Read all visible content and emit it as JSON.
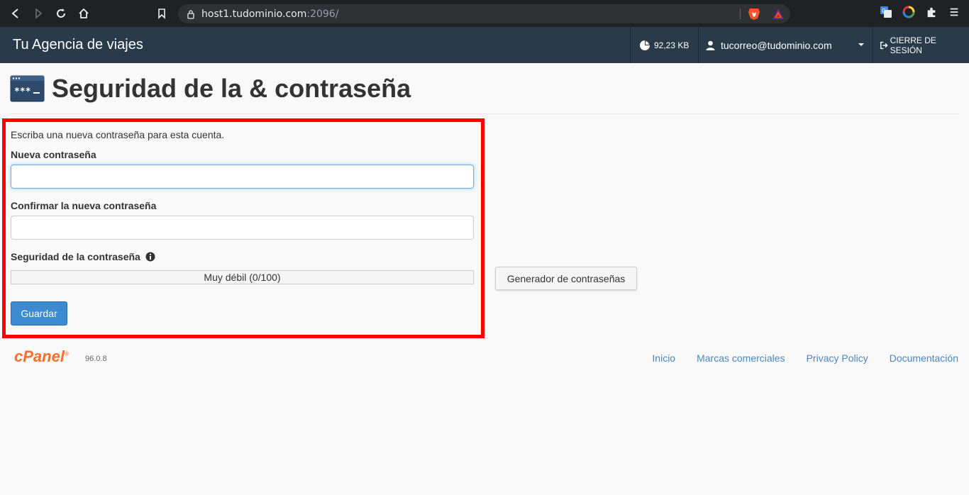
{
  "browser": {
    "url_host": "host1.tudominio.com",
    "url_port": ":2096/"
  },
  "topbar": {
    "brand": "Tu Agencia de viajes",
    "disk_usage": "92,23 KB",
    "user_email": "tucorreo@tudominio.com",
    "logout_label": "CIERRE DE SESIÓN"
  },
  "page": {
    "title": "Seguridad de la & contraseña"
  },
  "form": {
    "intro": "Escriba una nueva contraseña para esta cuenta.",
    "new_password_label": "Nueva contraseña",
    "new_password_value": "",
    "confirm_password_label": "Confirmar la nueva contraseña",
    "confirm_password_value": "",
    "strength_label": "Seguridad de la contraseña",
    "strength_text": "Muy débil (0/100)",
    "strength_value": 0,
    "generator_label": "Generador de contraseñas",
    "save_label": "Guardar"
  },
  "footer": {
    "logo": "cPanel",
    "version": "96.0.8",
    "links": [
      "Inicio",
      "Marcas comerciales",
      "Privacy Policy",
      "Documentación"
    ]
  },
  "colors": {
    "topbar_bg": "#293a4a",
    "highlight": "#ff0000",
    "primary_button": "#3c8ad0",
    "link": "#4a86bf",
    "cpanel_orange": "#ff6c2c"
  }
}
